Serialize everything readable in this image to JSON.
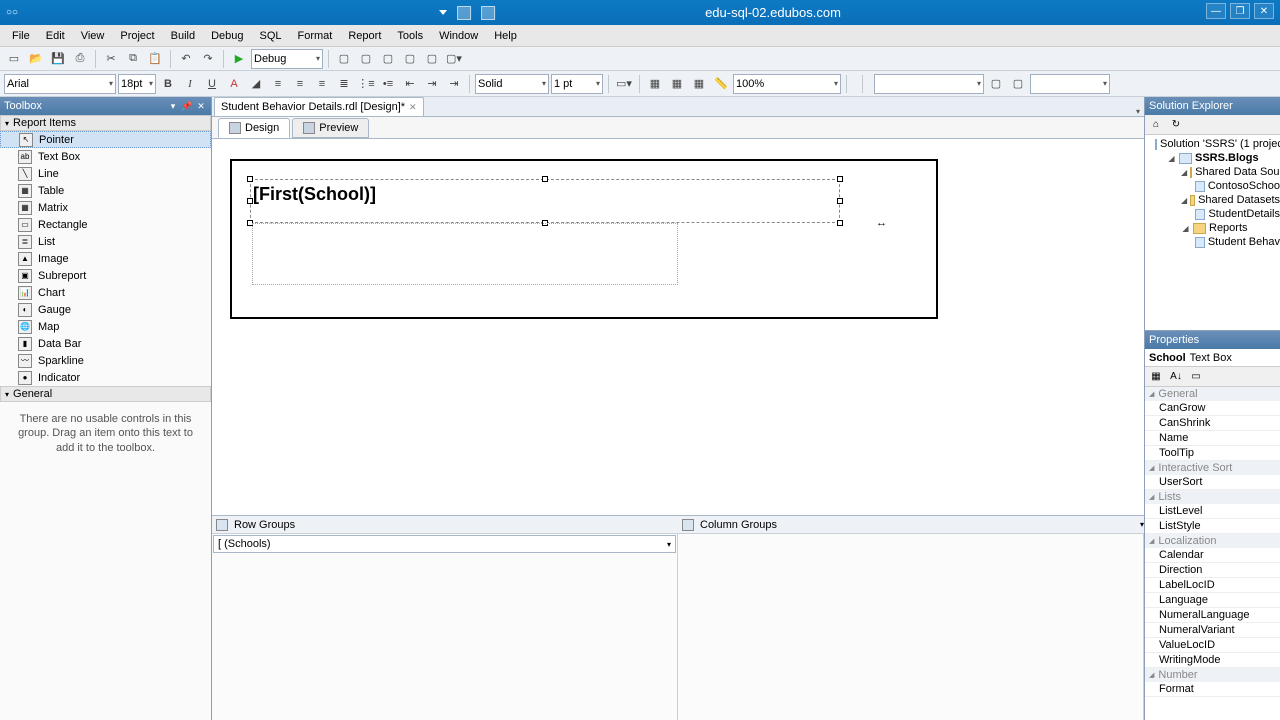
{
  "titlebar": {
    "title": "edu-sql-02.edubos.com"
  },
  "menu": [
    "File",
    "Edit",
    "View",
    "Project",
    "Build",
    "Debug",
    "SQL",
    "Format",
    "Report",
    "Tools",
    "Window",
    "Help"
  ],
  "toolbar1": {
    "config": "Debug"
  },
  "toolbar2": {
    "font": "Arial",
    "size": "18pt",
    "border_style": "Solid",
    "border_width": "1 pt",
    "zoom": "100%"
  },
  "toolbox": {
    "title": "Toolbox",
    "cats": [
      "Report Items",
      "General"
    ],
    "items": [
      "Pointer",
      "Text Box",
      "Line",
      "Table",
      "Matrix",
      "Rectangle",
      "List",
      "Image",
      "Subreport",
      "Chart",
      "Gauge",
      "Map",
      "Data Bar",
      "Sparkline",
      "Indicator"
    ],
    "msg": "There are no usable controls in this group. Drag an item onto this text to add it to the toolbox."
  },
  "doctab": {
    "label": "Student Behavior Details.rdl [Design]*"
  },
  "design": {
    "tabs": {
      "design": "Design",
      "preview": "Preview"
    },
    "textbox_expr": "[First(School)]"
  },
  "groups": {
    "row_label": "Row Groups",
    "col_label": "Column Groups",
    "row_item": "[ (Schools)"
  },
  "solution": {
    "title": "Solution Explorer",
    "root": "Solution 'SSRS' (1 project",
    "proj": "SSRS.Blogs",
    "folders": {
      "ds": "Shared Data Sourc",
      "dset": "Shared Datasets",
      "rep": "Reports"
    },
    "items": {
      "ds": "ContosoSchoo",
      "dset": "StudentDetails",
      "rep": "Student Behav"
    }
  },
  "properties": {
    "title": "Properties",
    "obj_name": "School",
    "obj_type": "Text Box",
    "cats": {
      "general": "General",
      "isort": "Interactive Sort",
      "lists": "Lists",
      "loc": "Localization",
      "num": "Number"
    },
    "props": {
      "CanGrow": "CanGrow",
      "CanShrink": "CanShrink",
      "Name": "Name",
      "ToolTip": "ToolTip",
      "UserSort": "UserSort",
      "ListLevel": "ListLevel",
      "ListStyle": "ListStyle",
      "Calendar": "Calendar",
      "Direction": "Direction",
      "LabelLocID": "LabelLocID",
      "Language": "Language",
      "NumeralLanguage": "NumeralLanguage",
      "NumeralVariant": "NumeralVariant",
      "ValueLocID": "ValueLocID",
      "WritingMode": "WritingMode",
      "Format": "Format"
    }
  }
}
